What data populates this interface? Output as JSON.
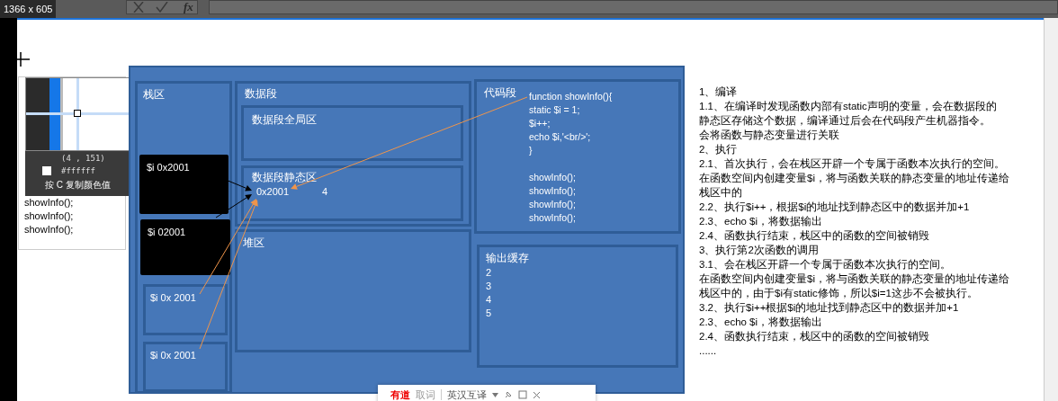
{
  "top_bar": {
    "size_badge": "1366 x 605",
    "formula_label": "fx"
  },
  "notes_box": {
    "lines": [
      "showInfo();",
      "showInfo();",
      "showInfo();"
    ]
  },
  "color_picker": {
    "coords": "(4 , 151)",
    "hex": "#ffffff",
    "hint": "按 C 复制颜色值"
  },
  "diagram": {
    "stack": {
      "title": "栈区",
      "frames": [
        {
          "label": "$i  0x2001",
          "kind": "filled"
        },
        {
          "label": "$i  02001",
          "kind": "filled"
        },
        {
          "label": "$i  0x 2001",
          "kind": "outlined"
        },
        {
          "label": "$i  0x 2001",
          "kind": "outlined"
        }
      ]
    },
    "data_segment": {
      "title": "数据段",
      "global_title": "数据段全局区",
      "static_title": "数据段静态区",
      "static_address": "0x2001",
      "static_value": "4"
    },
    "heap": {
      "title": "堆区"
    },
    "code_segment": {
      "title": "代码段",
      "code": [
        "function showInfo(){",
        "static $i = 1;",
        "$i++;",
        "echo $i,'<br/>';",
        "}"
      ],
      "calls": [
        "showInfo();",
        "showInfo();",
        "showInfo();",
        "showInfo();"
      ]
    },
    "output_buffer": {
      "title": "输出缓存",
      "lines": [
        "2",
        "3",
        "4",
        "5"
      ]
    }
  },
  "notes": [
    "1、编译",
    "1.1、在编译时发现函数内部有static声明的变量，会在数据段的",
    "静态区存储这个数据，编译通过后会在代码段产生机器指令。",
    "会将函数与静态变量进行关联",
    "2、执行",
    "2.1、首次执行，会在栈区开辟一个专属于函数本次执行的空间。",
    "在函数空间内创建变量$i，将与函数关联的静态变量的地址传递给",
    "栈区中的",
    "2.2、执行$i++，根据$i的地址找到静态区中的数据并加+1",
    "2.3、echo $i，将数据输出",
    "2.4、函数执行结束，栈区中的函数的空间被销毁",
    "3、执行第2次函数的调用",
    "3.1、会在栈区开辟一个专属于函数本次执行的空间。",
    "在函数空间内创建变量$i，将与函数关联的静态变量的地址传递给",
    "栈区中的，由于$i有static修饰，所以$i=1这步不会被执行。",
    "3.2、执行$i++根据$i的地址找到静态区中的数据并加+1",
    "2.3、echo $i，将数据输出",
    "2.4、函数执行结束，栈区中的函数的空间被销毁",
    "......"
  ],
  "translator_bar": {
    "brand": "有道",
    "mode": "取词",
    "language": "英汉互译"
  }
}
